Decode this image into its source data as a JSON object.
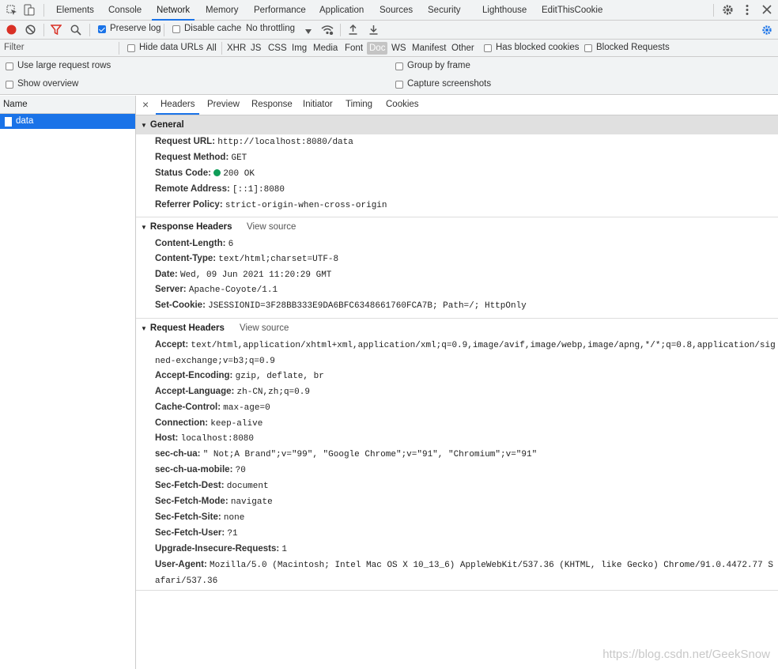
{
  "tabs": [
    "Elements",
    "Console",
    "Network",
    "Memory",
    "Performance",
    "Application",
    "Sources",
    "Security",
    "Lighthouse",
    "EditThisCookie"
  ],
  "toolbar": {
    "preserve_log": "Preserve log",
    "disable_cache": "Disable cache",
    "throttling": "No throttling"
  },
  "filterbar": {
    "placeholder": "Filter",
    "hide_data_urls": "Hide data URLs",
    "types": [
      "All",
      "XHR",
      "JS",
      "CSS",
      "Img",
      "Media",
      "Font",
      "Doc",
      "WS",
      "Manifest",
      "Other"
    ],
    "selected_type": "Doc",
    "has_blocked_cookies": "Has blocked cookies",
    "blocked_requests": "Blocked Requests"
  },
  "options": {
    "large_rows": "Use large request rows",
    "show_overview": "Show overview",
    "group_by_frame": "Group by frame",
    "capture_screenshots": "Capture screenshots"
  },
  "requests": {
    "column_name": "Name",
    "items": [
      "data"
    ]
  },
  "detail": {
    "close": "×",
    "tabs": [
      "Headers",
      "Preview",
      "Response",
      "Initiator",
      "Timing",
      "Cookies"
    ],
    "general": {
      "title": "General",
      "rows": [
        {
          "k": "Request URL:",
          "v": "http://localhost:8080/data"
        },
        {
          "k": "Request Method:",
          "v": "GET"
        },
        {
          "k": "Status Code:",
          "v": "200 OK"
        },
        {
          "k": "Remote Address:",
          "v": "[::1]:8080"
        },
        {
          "k": "Referrer Policy:",
          "v": "strict-origin-when-cross-origin"
        }
      ]
    },
    "response": {
      "title": "Response Headers",
      "view_source": "View source",
      "rows": [
        {
          "k": "Content-Length:",
          "v": "6"
        },
        {
          "k": "Content-Type:",
          "v": "text/html;charset=UTF-8"
        },
        {
          "k": "Date:",
          "v": "Wed, 09 Jun 2021 11:20:29 GMT"
        },
        {
          "k": "Server:",
          "v": "Apache-Coyote/1.1"
        },
        {
          "k": "Set-Cookie:",
          "v": "JSESSIONID=3F28BB333E9DA6BFC6348661760FCA7B; Path=/; HttpOnly"
        }
      ]
    },
    "request": {
      "title": "Request Headers",
      "view_source": "View source",
      "rows": [
        {
          "k": "Accept:",
          "v": "text/html,application/xhtml+xml,application/xml;q=0.9,image/avif,image/webp,image/apng,*/*;q=0.8,application/signed-exchange;v=b3;q=0.9"
        },
        {
          "k": "Accept-Encoding:",
          "v": "gzip, deflate, br"
        },
        {
          "k": "Accept-Language:",
          "v": "zh-CN,zh;q=0.9"
        },
        {
          "k": "Cache-Control:",
          "v": "max-age=0"
        },
        {
          "k": "Connection:",
          "v": "keep-alive"
        },
        {
          "k": "Host:",
          "v": "localhost:8080"
        },
        {
          "k": "sec-ch-ua:",
          "v": "\" Not;A Brand\";v=\"99\", \"Google Chrome\";v=\"91\", \"Chromium\";v=\"91\""
        },
        {
          "k": "sec-ch-ua-mobile:",
          "v": "?0"
        },
        {
          "k": "Sec-Fetch-Dest:",
          "v": "document"
        },
        {
          "k": "Sec-Fetch-Mode:",
          "v": "navigate"
        },
        {
          "k": "Sec-Fetch-Site:",
          "v": "none"
        },
        {
          "k": "Sec-Fetch-User:",
          "v": "?1"
        },
        {
          "k": "Upgrade-Insecure-Requests:",
          "v": "1"
        },
        {
          "k": "User-Agent:",
          "v": "Mozilla/5.0 (Macintosh; Intel Mac OS X 10_13_6) AppleWebKit/537.36 (KHTML, like Gecko) Chrome/91.0.4472.77 Safari/537.36"
        }
      ]
    }
  },
  "watermark": "https://blog.csdn.net/GeekSnow",
  "colors": {
    "accent": "#1a73e8",
    "record": "#d93025",
    "status_ok": "#0f9d58"
  }
}
